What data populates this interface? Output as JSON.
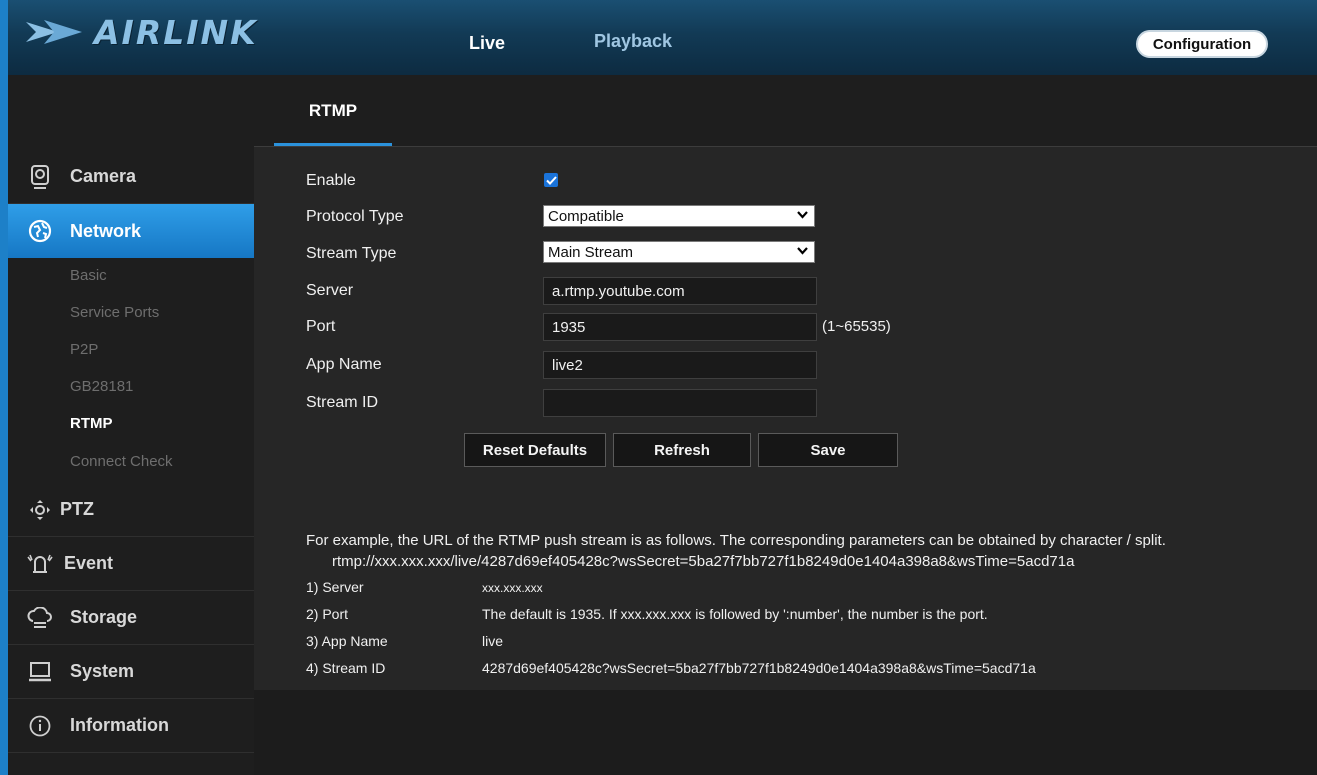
{
  "brand": {
    "logo_text": "AIRLINK"
  },
  "header": {
    "live": "Live",
    "playback": "Playback",
    "configuration": "Configuration"
  },
  "sidebar": {
    "camera": "Camera",
    "network": "Network",
    "network_sub": [
      "Basic",
      "Service Ports",
      "P2P",
      "GB28181",
      "RTMP",
      "Connect Check"
    ],
    "ptz": "PTZ",
    "event": "Event",
    "storage": "Storage",
    "system": "System",
    "information": "Information"
  },
  "tab": {
    "label": "RTMP"
  },
  "form": {
    "enable_label": "Enable",
    "enable_checked": true,
    "protocol_label": "Protocol Type",
    "protocol_value": "Compatible",
    "stream_type_label": "Stream Type",
    "stream_type_value": "Main Stream",
    "server_label": "Server",
    "server_value": "a.rtmp.youtube.com",
    "port_label": "Port",
    "port_value": "1935",
    "port_hint": "(1~65535)",
    "app_name_label": "App Name",
    "app_name_value": "live2",
    "stream_id_label": "Stream ID",
    "stream_id_value": ""
  },
  "buttons": {
    "reset": "Reset Defaults",
    "refresh": "Refresh",
    "save": "Save"
  },
  "example": {
    "intro": "For example, the URL of the RTMP push stream is as follows. The corresponding parameters can be obtained by character / split.",
    "url": "rtmp://xxx.xxx.xxx/live/4287d69ef405428c?wsSecret=5ba27f7bb727f1b8249d0e1404a398a8&wsTime=5acd71a",
    "rows": [
      {
        "label": "1) Server",
        "value": "xxx.xxx.xxx"
      },
      {
        "label": "2) Port",
        "value": "The default is 1935. If xxx.xxx.xxx is followed by ':number', the number is the port."
      },
      {
        "label": "3) App Name",
        "value": "live"
      },
      {
        "label": "4) Stream ID",
        "value": "4287d69ef405428c?wsSecret=5ba27f7bb727f1b8249d0e1404a398a8&wsTime=5acd71a"
      }
    ]
  },
  "colors": {
    "accent": "#1f86d2",
    "header_bg": "#123a55",
    "checkbox": "#1a73d9"
  }
}
